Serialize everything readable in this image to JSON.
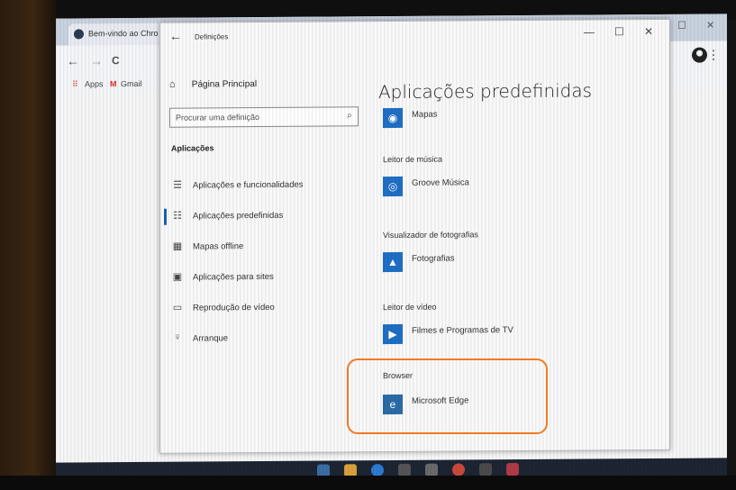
{
  "chrome": {
    "tab_title": "Bem-vindo ao Chro",
    "win_min": "—",
    "win_max": "☐",
    "win_close": "✕",
    "nav_back": "←",
    "nav_forward": "→",
    "nav_reload": "C",
    "menu_glyph": "⋮",
    "bookmarks": [
      {
        "label": "Apps"
      },
      {
        "label": "Gmail"
      }
    ]
  },
  "settings": {
    "title": "Definições",
    "back_glyph": "←",
    "win_min": "—",
    "win_max": "☐",
    "win_close": "✕",
    "home_label": "Página Principal",
    "search_placeholder": "Procurar uma definição",
    "section_label": "Aplicações",
    "nav": [
      {
        "label": "Aplicações e funcionalidades",
        "icon": "list-icon",
        "glyph": "☰"
      },
      {
        "label": "Aplicações predefinidas",
        "icon": "default-apps-icon",
        "glyph": "☷",
        "selected": true
      },
      {
        "label": "Mapas offline",
        "icon": "map-icon",
        "glyph": "▦"
      },
      {
        "label": "Aplicações para sites",
        "icon": "web-app-icon",
        "glyph": "▣"
      },
      {
        "label": "Reprodução de vídeo",
        "icon": "video-icon",
        "glyph": "▭"
      },
      {
        "label": "Arranque",
        "icon": "startup-icon",
        "glyph": "♀"
      }
    ],
    "page_title": "Aplicações predefinidas",
    "defaults": [
      {
        "category": "",
        "app": "Mapas",
        "glyph": "◉"
      },
      {
        "category": "Leitor de música",
        "app": "Groove Música",
        "glyph": "◎"
      },
      {
        "category": "Visualizador de fotografias",
        "app": "Fotografias",
        "glyph": "▲"
      },
      {
        "category": "Leitor de vídeo",
        "app": "Filmes e Programas de TV",
        "glyph": "▶"
      },
      {
        "category": "Browser",
        "app": "Microsoft Edge",
        "glyph": "e"
      }
    ]
  },
  "colors": {
    "highlight": "#f07a24",
    "accent": "#1a5fb4"
  }
}
